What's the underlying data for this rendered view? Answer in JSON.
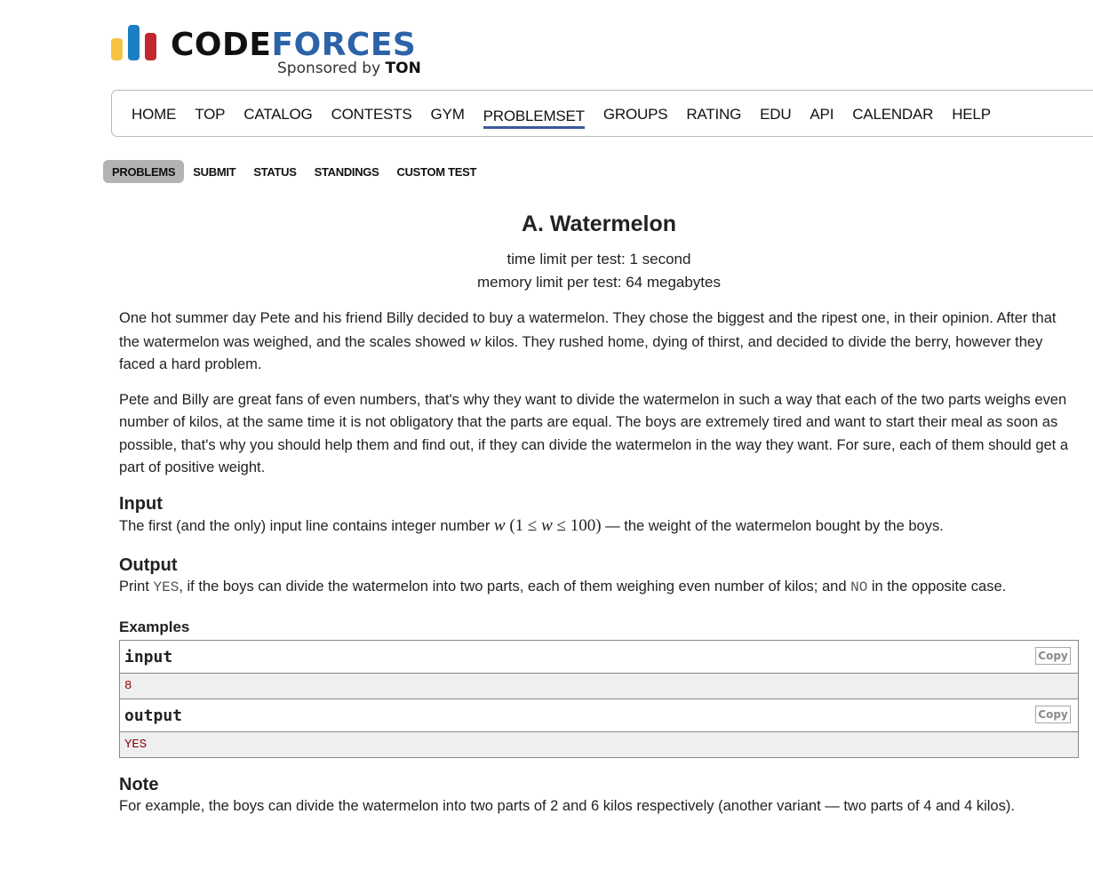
{
  "logo": {
    "word_part1": "CODE",
    "word_part2": "FORCES",
    "sponsor_prefix": "Sponsored by",
    "sponsor_name": "TON",
    "bar_colors": [
      "#f5c443",
      "#1d7fc3",
      "#c2262f"
    ]
  },
  "main_menu": {
    "items": [
      "HOME",
      "TOP",
      "CATALOG",
      "CONTESTS",
      "GYM",
      "PROBLEMSET",
      "GROUPS",
      "RATING",
      "EDU",
      "API",
      "CALENDAR",
      "HELP"
    ],
    "active": "PROBLEMSET"
  },
  "sub_menu": {
    "items": [
      "PROBLEMS",
      "SUBMIT",
      "STATUS",
      "STANDINGS",
      "CUSTOM TEST"
    ],
    "selected": "PROBLEMS"
  },
  "problem": {
    "title": "A. Watermelon",
    "time_limit": "time limit per test: 1 second",
    "memory_limit": "memory limit per test: 64 megabytes",
    "legend": {
      "p1_before": "One hot summer day Pete and his friend Billy decided to buy a watermelon. They chose the biggest and the ripest one, in their opinion. After that the watermelon was weighed, and the scales showed ",
      "p1_math": "w",
      "p1_after": " kilos. They rushed home, dying of thirst, and decided to divide the berry, however they faced a hard problem.",
      "p2": "Pete and Billy are great fans of even numbers, that's why they want to divide the watermelon in such a way that each of the two parts weighs even number of kilos, at the same time it is not obligatory that the parts are equal. The boys are extremely tired and want to start their meal as soon as possible, that's why you should help them and find out, if they can divide the watermelon in the way they want. For sure, each of them should get a part of positive weight."
    },
    "input": {
      "title": "Input",
      "before": "The first (and the only) input line contains integer number ",
      "math_var": "w",
      "math_open": " (1 ≤ ",
      "math_var2": "w",
      "math_close": " ≤ 100)",
      "after": " — the weight of the watermelon bought by the boys."
    },
    "output": {
      "title": "Output",
      "before": "Print ",
      "yes": "YES",
      "middle": ", if the boys can divide the watermelon into two parts, each of them weighing even number of kilos; and ",
      "no": "NO",
      "after": " in the opposite case."
    },
    "examples": {
      "title": "Examples",
      "input_label": "input",
      "input_value": "8",
      "output_label": "output",
      "output_value": "YES",
      "copy_label": "Copy"
    },
    "note": {
      "title": "Note",
      "text": "For example, the boys can divide the watermelon into two parts of 2 and 6 kilos respectively (another variant — two parts of 4 and 4 kilos)."
    }
  }
}
